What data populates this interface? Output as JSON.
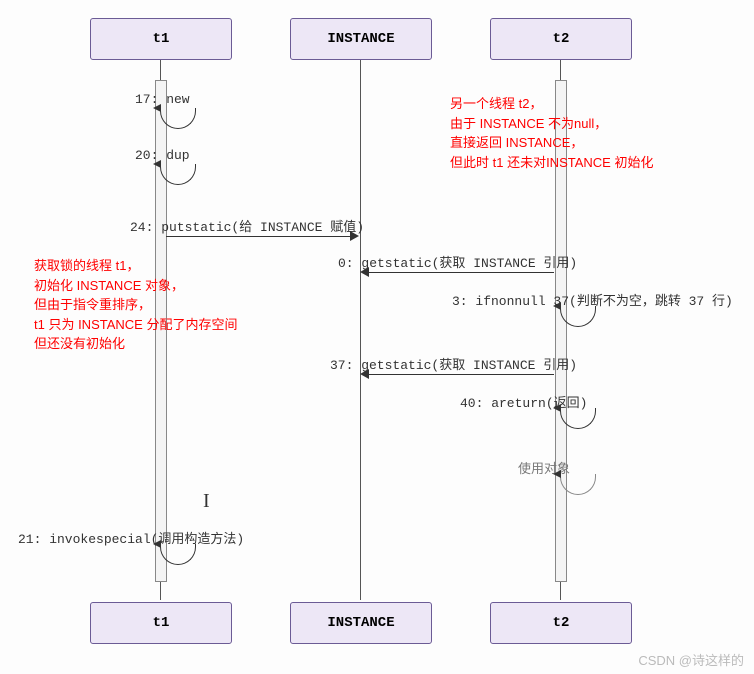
{
  "participants": {
    "t1": "t1",
    "instance": "INSTANCE",
    "t2": "t2"
  },
  "messages": {
    "new17": "17: new",
    "dup20": "20: dup",
    "putstatic24": "24: putstatic(给 INSTANCE 赋值)",
    "getstatic0": "0: getstatic(获取 INSTANCE 引用)",
    "ifnonnull3": "3: ifnonnull 37(判断不为空，跳转 37 行)",
    "getstatic37": "37: getstatic(获取 INSTANCE 引用)",
    "areturn40": "40: areturn(返回)",
    "useobj": "使用对象",
    "invokespecial21": "21: invokespecial(调用构造方法)"
  },
  "notes": {
    "right": {
      "l1": "另一个线程 t2，",
      "l2": "由于 INSTANCE 不为null，",
      "l3": "直接返回 INSTANCE，",
      "l4": "但此时 t1 还未对INSTANCE 初始化"
    },
    "left": {
      "l1": "获取锁的线程 t1，",
      "l2": "初始化 INSTANCE 对象，",
      "l3": "但由于指令重排序，",
      "l4": "t1 只为 INSTANCE 分配了内存空间",
      "l5": "但还没有初始化"
    }
  },
  "watermark": "CSDN @诗这样的"
}
